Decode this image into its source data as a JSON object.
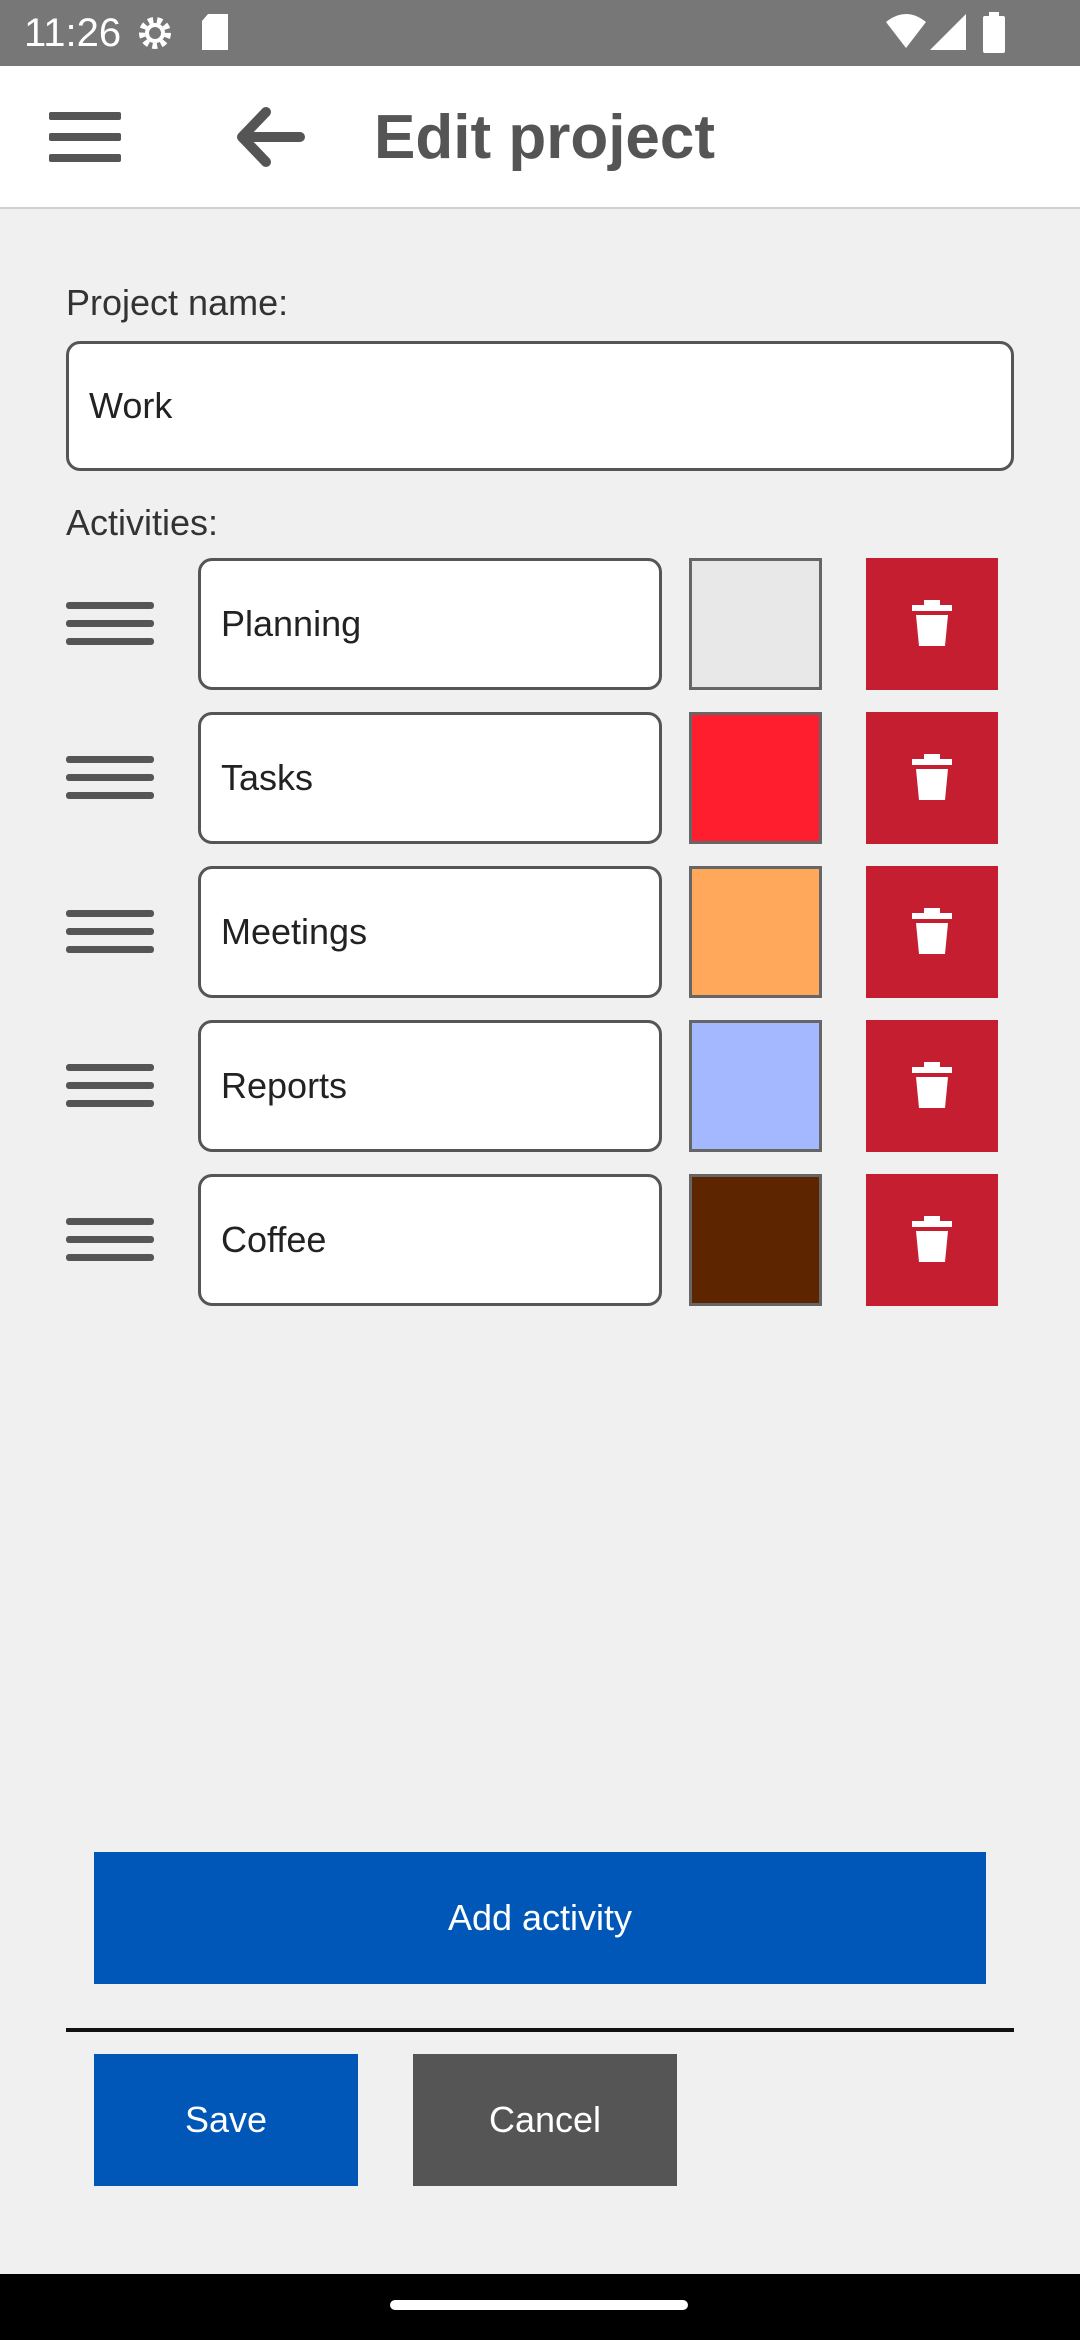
{
  "status_bar": {
    "time": "11:26",
    "icons": [
      "settings-gear-icon",
      "sd-card-icon",
      "wifi-icon",
      "cell-signal-icon",
      "battery-icon"
    ]
  },
  "app_bar": {
    "title": "Edit project",
    "menu_icon": "hamburger-menu-icon",
    "back_icon": "arrow-back-icon"
  },
  "form": {
    "project_label": "Project name:",
    "project_name": "Work",
    "activities_label": "Activities:",
    "activities": [
      {
        "name": "Planning",
        "color": "#e8e8e8"
      },
      {
        "name": "Tasks",
        "color": "#ff1e2d"
      },
      {
        "name": "Meetings",
        "color": "#ffa85c"
      },
      {
        "name": "Reports",
        "color": "#a4b8ff"
      },
      {
        "name": "Coffee",
        "color": "#5e2600"
      }
    ],
    "delete_icon": "trash-icon",
    "drag_icon": "drag-handle-icon"
  },
  "buttons": {
    "add_activity": "Add activity",
    "save": "Save",
    "cancel": "Cancel"
  },
  "colors": {
    "primary": "#0057b8",
    "danger": "#c41e30",
    "secondary": "#555555"
  }
}
